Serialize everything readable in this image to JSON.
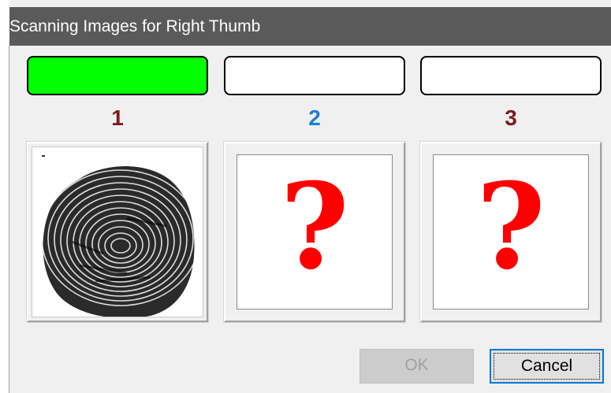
{
  "window": {
    "title": "Scanning Images for Right Thumb"
  },
  "colors": {
    "progress_done": "#00ff00",
    "progress_pending": "#ffffff",
    "current_number": "#1e7fd6",
    "other_number": "#7b1c1c",
    "question_mark": "#ff0000"
  },
  "scans": [
    {
      "number": "1",
      "status": "done",
      "image": "fingerprint-image"
    },
    {
      "number": "2",
      "status": "current",
      "image": "question-mark",
      "glyph": "?"
    },
    {
      "number": "3",
      "status": "pending",
      "image": "question-mark",
      "glyph": "?"
    }
  ],
  "buttons": {
    "ok": "OK",
    "cancel": "Cancel"
  }
}
